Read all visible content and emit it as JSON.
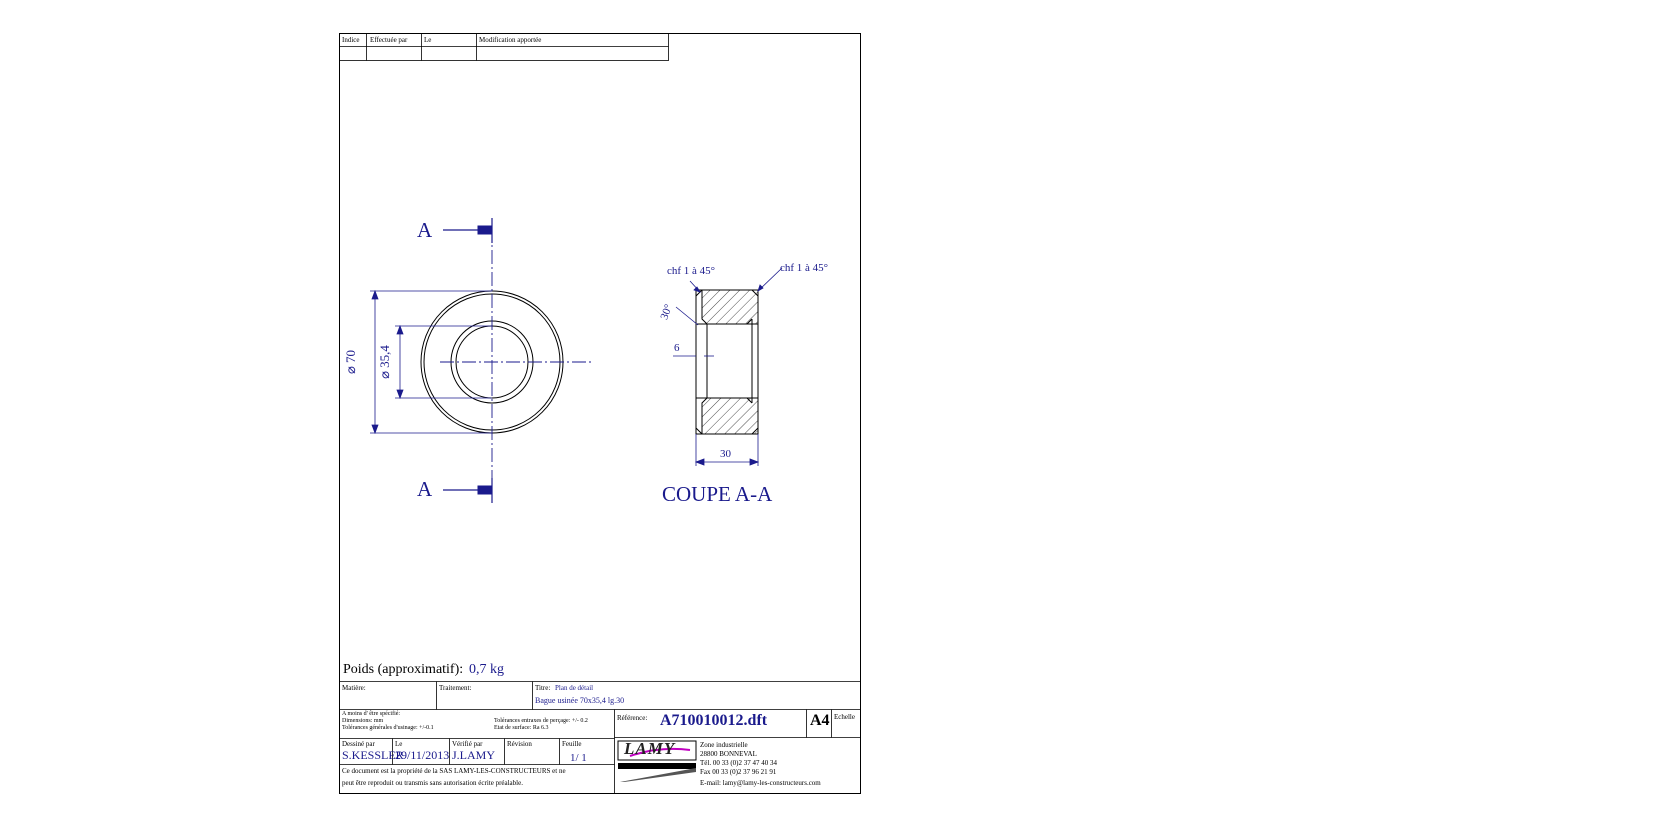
{
  "revision_table": {
    "headers": [
      "Indice",
      "Effectuée par",
      "Le",
      "Modification apportée"
    ]
  },
  "drawing": {
    "section_mark_top": "A",
    "section_mark_bottom": "A",
    "dim_outer_diameter": "⌀ 70",
    "dim_inner_diameter": "⌀ 35,4",
    "chamfer_left": "chf 1 à 45°",
    "chamfer_right": "chf 1 à 45°",
    "angle": "30°",
    "dim_depth": "6",
    "dim_width": "30",
    "section_title": "COUPE A-A"
  },
  "weight": {
    "label": "Poids (approximatif):",
    "value": "0,7 kg"
  },
  "title_block": {
    "matiere_label": "Matière:",
    "traitement_label": "Traitement:",
    "titre_label": "Titre:",
    "titre_value": "Plan de détail",
    "titre_line2": "Bague usinée 70x35,4 lg.30",
    "spec_line1": "A moins d' être spécifié:",
    "spec_line2": "Dimensions: mm",
    "spec_line3": "Tolérances générales d'usinage: +/-0.1",
    "tol_line1": "Tolérances entraxes de perçage: +/- 0.2",
    "tol_line2": "Etat de surface: Ra 6.3",
    "reference_label": "Référence:",
    "reference_value": "A710010012.dft",
    "format": "A4",
    "echelle_label": "Echelle",
    "dessine_label": "Dessiné par",
    "dessine_value": "S.KESSLER",
    "le_label": "Le",
    "le_value": "29/11/2013",
    "verifie_label": "Vérifié par",
    "verifie_value": "J.LAMY",
    "revision_label": "Révision",
    "feuille_label": "Feuille",
    "feuille_value": "1/  1",
    "copyright_line1": "Ce document est la propriété de la SAS LAMY-LES-CONSTRUCTEURS et ne",
    "copyright_line2": "peut être reproduit ou transmis sans autorisation écrite préalable.",
    "logo_text": "LAMY",
    "address_line1": "Zone industrielle",
    "address_line2": "28800 BONNEVAL",
    "address_line3": "Tél. 00 33 (0)2 37 47 40 34",
    "address_line4": "Fax 00 33 (0)2 37 96 21 91",
    "address_line5": "E-mail: lamy@lamy-les-constructeurs.com"
  }
}
